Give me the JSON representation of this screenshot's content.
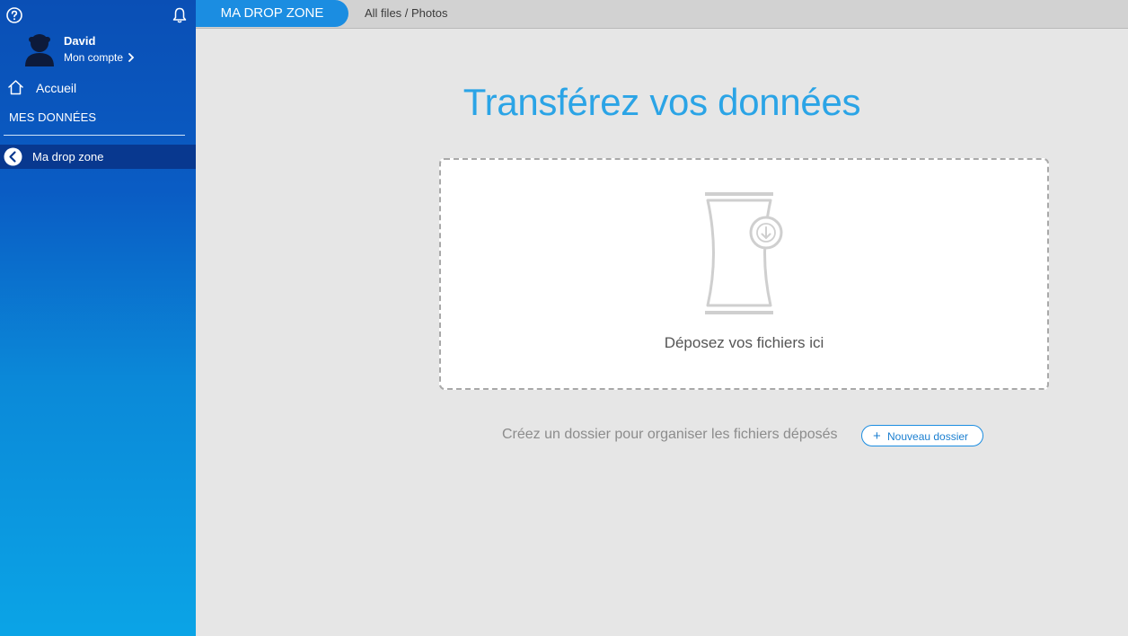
{
  "sidebar": {
    "user": {
      "name": "David",
      "account_label": "Mon compte"
    },
    "nav_home_label": "Accueil",
    "section_heading": "MES DONNÉES",
    "nav_active_label": "Ma drop zone",
    "icons": [
      "help-icon",
      "bell-icon",
      "avatar",
      "chevron-right-icon",
      "home-icon",
      "back-icon"
    ]
  },
  "topbar": {
    "tab_label": "MA DROP ZONE",
    "breadcrumb": "All files / Photos"
  },
  "main": {
    "title": "Transférez vos données",
    "dropzone_text": "Déposez vos fichiers ici",
    "hint_text": "Créez un dossier pour organiser les fichiers déposés",
    "new_folder_label": "Nouveau dossier",
    "new_folder_icon": "+"
  },
  "colors": {
    "accent": "#1b8de1",
    "title": "#2ba4e6",
    "sidebar_top": "#0a4fb5",
    "sidebar_bottom": "#0ba4e6",
    "active_nav": "#08388f"
  }
}
